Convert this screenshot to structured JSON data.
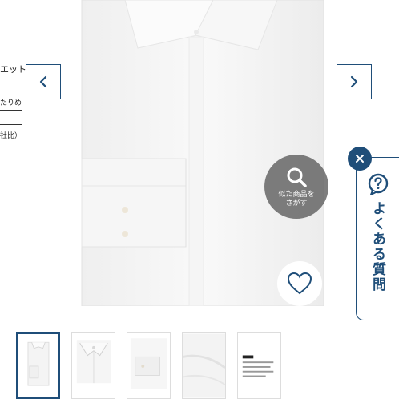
{
  "side_panel": {
    "line1": "エット",
    "line2": "たりめ",
    "line3": "社比）"
  },
  "nav": {
    "prev_icon": "chevron-left-icon",
    "next_icon": "chevron-right-icon"
  },
  "similar": {
    "icon": "search-icon",
    "label_line1": "似た商品を",
    "label_line2": "さがす"
  },
  "favorite": {
    "icon": "heart-icon"
  },
  "faq": {
    "icon": "question-chat-icon",
    "label": "よくある質問",
    "close_icon": "close-icon"
  },
  "thumbnails": [
    {
      "kind": "folded-shirt",
      "active": true
    },
    {
      "kind": "collar-detail",
      "active": false
    },
    {
      "kind": "cuff-detail",
      "active": false
    },
    {
      "kind": "fabric-detail",
      "active": false
    },
    {
      "kind": "label-tag",
      "active": false
    }
  ],
  "colors": {
    "accent": "#1f4e79",
    "overlay": "#5a5a5a"
  }
}
